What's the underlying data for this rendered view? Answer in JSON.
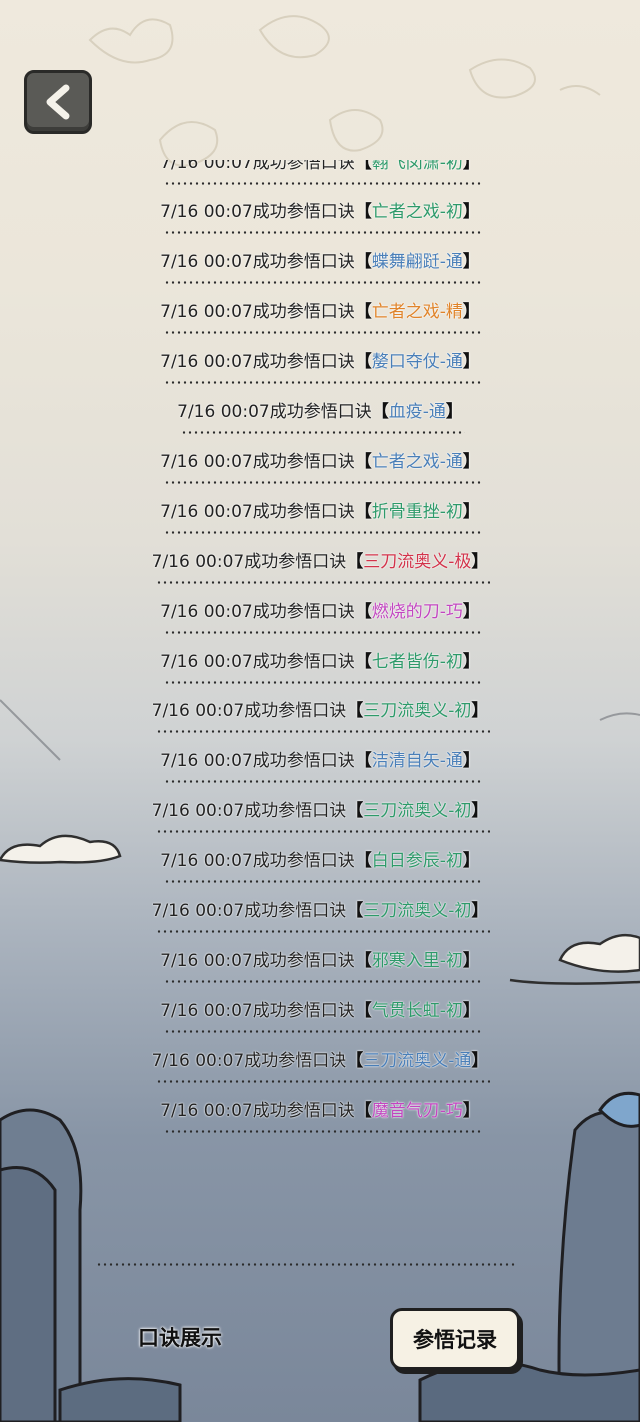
{
  "header": {
    "back_icon": "chevron-left-icon"
  },
  "log": {
    "prefix": "7/16 00:07成功参悟口诀",
    "open_bracket": "【",
    "close_bracket": "】",
    "entries": [
      {
        "skill": "翱飞闵潇-初",
        "color": "#2e9a6a"
      },
      {
        "skill": "亡者之戏-初",
        "color": "#2e9a6a"
      },
      {
        "skill": "蝶舞翩跹-通",
        "color": "#4a7fb8"
      },
      {
        "skill": "亡者之戏-精",
        "color": "#e0842a"
      },
      {
        "skill": "嫠口夺仗-通",
        "color": "#4a7fb8"
      },
      {
        "skill": "血疫-通",
        "color": "#4a7fb8"
      },
      {
        "skill": "亡者之戏-通",
        "color": "#4a7fb8"
      },
      {
        "skill": "折骨重挫-初",
        "color": "#2e9a6a"
      },
      {
        "skill": "三刀流奥义-极",
        "color": "#d2334a"
      },
      {
        "skill": "燃烧的刀-巧",
        "color": "#c246c0"
      },
      {
        "skill": "七者皆伤-初",
        "color": "#2e9a6a"
      },
      {
        "skill": "三刀流奥义-初",
        "color": "#2e9a6a"
      },
      {
        "skill": "洁清自矢-通",
        "color": "#4a7fb8"
      },
      {
        "skill": "三刀流奥义-初",
        "color": "#2e9a6a"
      },
      {
        "skill": "白日参辰-初",
        "color": "#2e9a6a"
      },
      {
        "skill": "三刀流奥义-初",
        "color": "#2e9a6a"
      },
      {
        "skill": "邪寒入里-初",
        "color": "#2e9a6a"
      },
      {
        "skill": "气贯长虹-初",
        "color": "#2e9a6a"
      },
      {
        "skill": "三刀流奥义-通",
        "color": "#4a7fb8"
      },
      {
        "skill": "魔音气刃-巧",
        "color": "#c246c0"
      }
    ]
  },
  "footer": {
    "tab_display_label": "口诀展示",
    "tab_record_label": "参悟记录"
  }
}
